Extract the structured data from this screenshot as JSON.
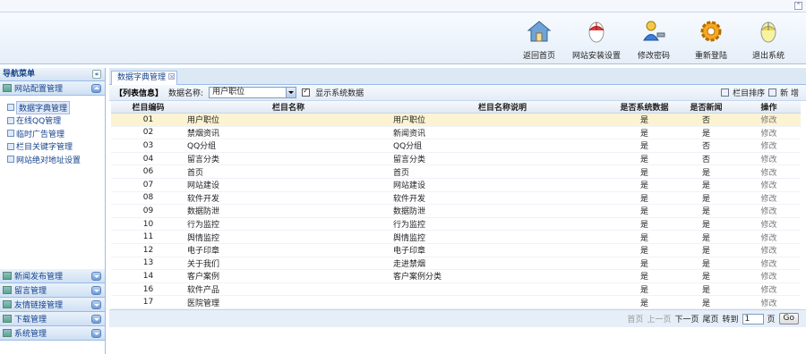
{
  "header": {
    "buttons": [
      {
        "label": "返回首页",
        "icon": "house-icon"
      },
      {
        "label": "网站安装设置",
        "icon": "mouse-icon"
      },
      {
        "label": "修改密码",
        "icon": "user-key-icon"
      },
      {
        "label": "重新登陆",
        "icon": "gear-icon"
      },
      {
        "label": "退出系统",
        "icon": "power-mouse-icon"
      }
    ]
  },
  "nav": {
    "title": "导航菜单",
    "collapse_glyph": "«",
    "active_section": "网站配置管理",
    "items": [
      "数据字典管理",
      "在线QQ管理",
      "临时广告管理",
      "栏目关键字管理",
      "网站绝对地址设置"
    ],
    "sections": [
      "新闻发布管理",
      "留言管理",
      "友情链接管理",
      "下载管理",
      "系统管理"
    ]
  },
  "main": {
    "tab_label": "数据字典管理",
    "filter": {
      "title": "【列表信息】",
      "data_label": "数据名称:",
      "data_value": "用户职位",
      "show_system_label": "显示系统数据",
      "sort_label": "栏目排序",
      "add_label": "新 增"
    },
    "columns": [
      "栏目编码",
      "栏目名称",
      "栏目名称说明",
      "是否系统数据",
      "是否新闻",
      "操作"
    ],
    "rows": [
      {
        "code": "01",
        "name": "用户职位",
        "desc": "用户职位",
        "sys": "是",
        "news": "否",
        "op": "修改"
      },
      {
        "code": "02",
        "name": "禁烟资讯",
        "desc": "新闻资讯",
        "sys": "是",
        "news": "是",
        "op": "修改"
      },
      {
        "code": "03",
        "name": "QQ分组",
        "desc": "QQ分组",
        "sys": "是",
        "news": "否",
        "op": "修改"
      },
      {
        "code": "04",
        "name": "留言分类",
        "desc": "留言分类",
        "sys": "是",
        "news": "否",
        "op": "修改"
      },
      {
        "code": "06",
        "name": "首页",
        "desc": "首页",
        "sys": "是",
        "news": "是",
        "op": "修改"
      },
      {
        "code": "07",
        "name": "网站建设",
        "desc": "网站建设",
        "sys": "是",
        "news": "是",
        "op": "修改"
      },
      {
        "code": "08",
        "name": "软件开发",
        "desc": "软件开发",
        "sys": "是",
        "news": "是",
        "op": "修改"
      },
      {
        "code": "09",
        "name": "数据防泄",
        "desc": "数据防泄",
        "sys": "是",
        "news": "是",
        "op": "修改"
      },
      {
        "code": "10",
        "name": "行为监控",
        "desc": "行为监控",
        "sys": "是",
        "news": "是",
        "op": "修改"
      },
      {
        "code": "11",
        "name": "舆情监控",
        "desc": "舆情监控",
        "sys": "是",
        "news": "是",
        "op": "修改"
      },
      {
        "code": "12",
        "name": "电子印章",
        "desc": "电子印章",
        "sys": "是",
        "news": "是",
        "op": "修改"
      },
      {
        "code": "13",
        "name": "关于我们",
        "desc": "走进禁烟",
        "sys": "是",
        "news": "是",
        "op": "修改"
      },
      {
        "code": "14",
        "name": "客户案例",
        "desc": "客户案例分类",
        "sys": "是",
        "news": "是",
        "op": "修改"
      },
      {
        "code": "16",
        "name": "软件产品",
        "desc": "",
        "sys": "是",
        "news": "是",
        "op": "修改"
      },
      {
        "code": "17",
        "name": "医院管理",
        "desc": "",
        "sys": "是",
        "news": "是",
        "op": "修改"
      }
    ],
    "pager": {
      "first": "首页",
      "prev": "上一页",
      "next": "下一页",
      "last": "尾页",
      "goto_label": "转到",
      "page_value": "1",
      "page_suffix": "页",
      "go_label": "Go"
    }
  }
}
